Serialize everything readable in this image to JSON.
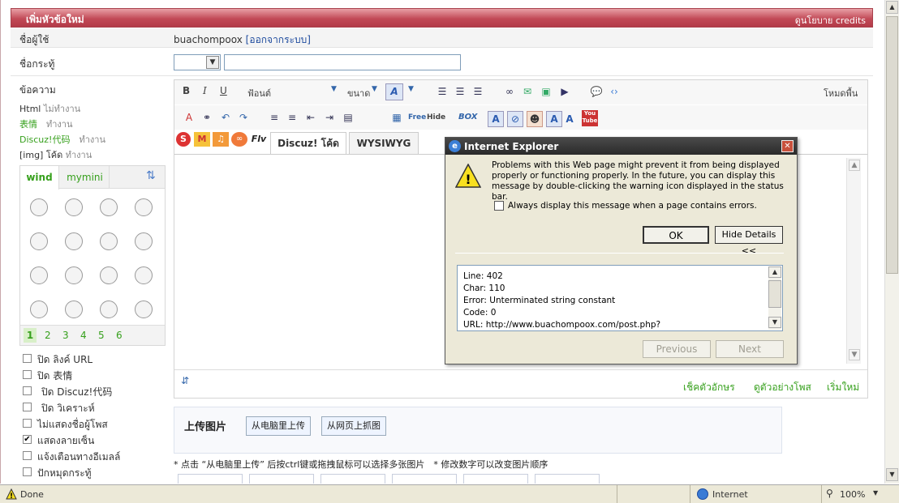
{
  "header": {
    "title": "เพิ่มหัวข้อใหม่",
    "right": "ดูนโยบาย credits"
  },
  "form": {
    "user_label": "ชื่อผู้ใช้",
    "username": "buachompoox",
    "logout_open": "[",
    "logout": "ออกจากระบบ",
    "logout_close": "]",
    "subject_label": "ชื่อกระทู้",
    "message_label": "ข้อความ"
  },
  "modes": {
    "html": "Html",
    "html_state": "ไม่ทำงาน",
    "smilies": "表情",
    "smilies_state": "ทำงาน",
    "discuz": "Discuz!代码",
    "discuz_state": "ทำงาน",
    "img": "[img] โค้ด",
    "img_state": "ทำงาน"
  },
  "smiley_tabs": [
    "wind",
    "mymini"
  ],
  "smiley_pages": [
    "1",
    "2",
    "3",
    "4",
    "5",
    "6"
  ],
  "toolbar": {
    "font": "ฟ้อนต์",
    "size": "ขนาด",
    "mode": "โหมดพื้น",
    "free": "Free",
    "hide": "Hide",
    "box": "BOX",
    "youtube": "You Tube",
    "flv": "Flv"
  },
  "editor_tabs": [
    "Discuz! โค้ด",
    "WYSIWYG"
  ],
  "editor_footer": {
    "check": "เช็คตัวอักษร",
    "preview": "ดูตัวอย่างโพส",
    "reset": "เริ่มใหม่"
  },
  "options": [
    "ปิด ลิงค์ URL",
    "ปิด 表情",
    "ปิด Discuz!代码",
    "ปิด วิเคราะห์",
    "ไม่แสดงชื่อผู้โพส",
    "แสดงลายเซ็น",
    "แจ้งเตือนทางอีเมลล์",
    "ปักหมุดกระทู้"
  ],
  "option_checked": [
    false,
    false,
    false,
    false,
    false,
    true,
    false,
    false
  ],
  "upload": {
    "title": "上传图片",
    "from_pc": "从电脑里上传",
    "from_web": "从网页上抓图",
    "note": "* 点击 “从电脑里上传” 后按ctrl键或拖拽鼠标可以选择多张图片　* 修改数字可以改变图片顺序"
  },
  "dialog": {
    "title": "Internet Explorer",
    "message": "Problems with this Web page might prevent it from being displayed properly or functioning properly. In the future, you can display this message by double-clicking the warning icon displayed in the status bar.",
    "checkbox": "Always display this message when a page contains errors.",
    "ok": "OK",
    "hide_details": "Hide Details <<",
    "details": [
      "Line:  402",
      "Char:  110",
      "Error:  Unterminated string constant",
      "Code:  0",
      "URL:  http://www.buachompoox.com/post.php?"
    ],
    "previous": "Previous",
    "next": "Next"
  },
  "statusbar": {
    "done": "Done",
    "zone": "Internet",
    "zoom": "100%"
  },
  "colors": {
    "header": "#c24a57",
    "accent_green": "#36a01c",
    "link_blue": "#1e4b9e"
  }
}
